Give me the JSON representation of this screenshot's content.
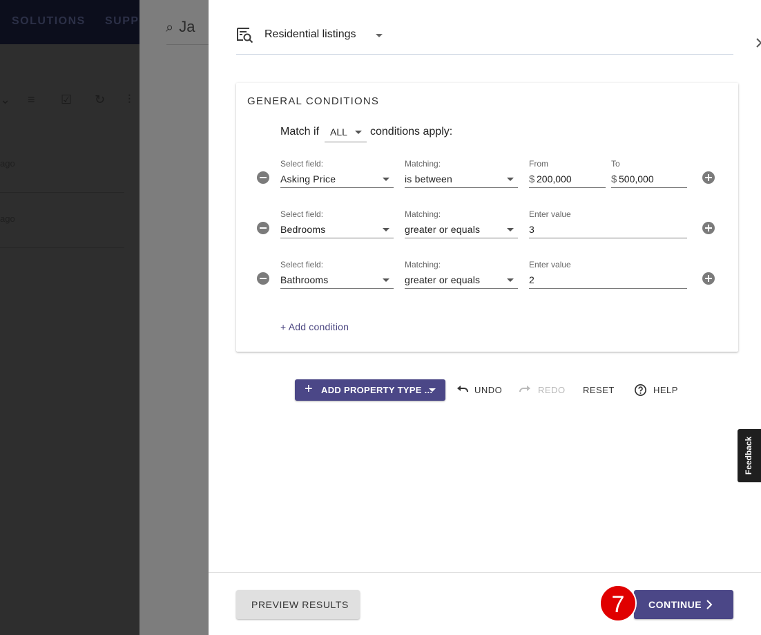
{
  "background": {
    "nav": [
      "SOLUTIONS",
      "SUPP"
    ],
    "panel_title": "Ja",
    "rows": [
      "ago",
      "ago"
    ]
  },
  "header": {
    "title": "Residential listings"
  },
  "card": {
    "title": "GENERAL CONDITIONS",
    "match": {
      "prefix": "Match if",
      "value": "ALL",
      "suffix": "conditions apply:"
    },
    "conditions": [
      {
        "field_label": "Select field:",
        "field": "Asking Price",
        "matching_label": "Matching:",
        "matching": "is between",
        "from_label": "From",
        "from_currency": "$",
        "from": "200,000",
        "to_label": "To",
        "to_currency": "$",
        "to": "500,000"
      },
      {
        "field_label": "Select field:",
        "field": "Bedrooms",
        "matching_label": "Matching:",
        "matching": "greater or equals",
        "value_label": "Enter value",
        "value": "3"
      },
      {
        "field_label": "Select field:",
        "field": "Bathrooms",
        "matching_label": "Matching:",
        "matching": "greater or equals",
        "value_label": "Enter value",
        "value": "2"
      }
    ],
    "add_condition": "+ Add condition"
  },
  "toolbar": {
    "add_property_type": "ADD PROPERTY TYPE ...",
    "undo": "UNDO",
    "redo": "REDO",
    "reset": "RESET",
    "help": "HELP"
  },
  "footer": {
    "preview": "PREVIEW RESULTS",
    "continue": "CONTINUE",
    "step_badge": "7"
  },
  "feedback": "Feedback",
  "colors": {
    "primary": "#4b4787",
    "badge": "#e00000"
  }
}
